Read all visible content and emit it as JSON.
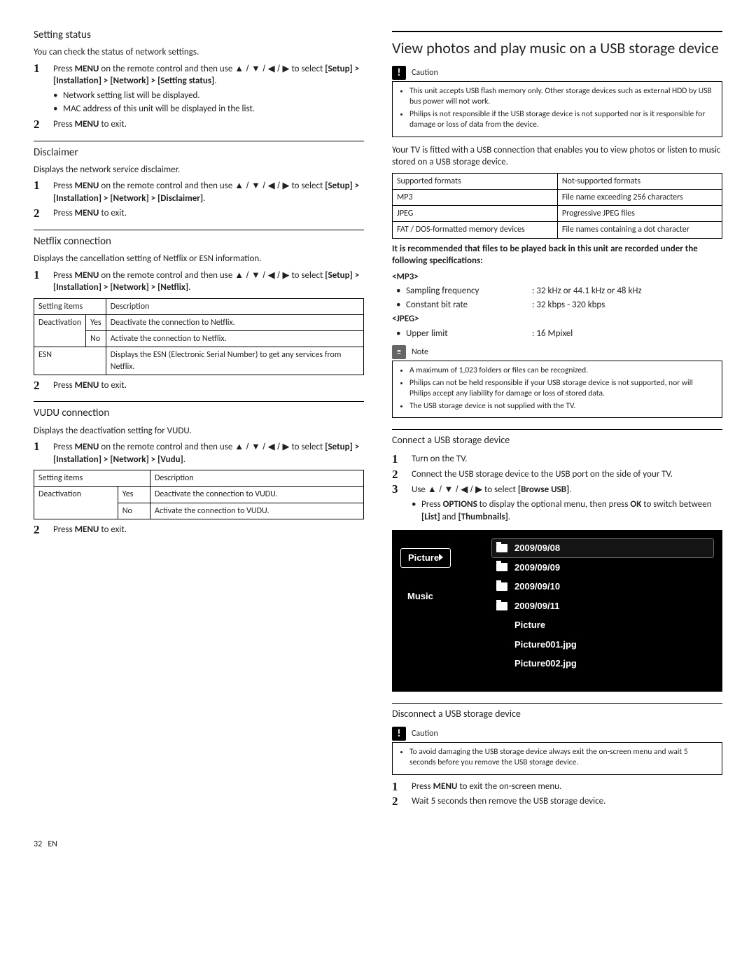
{
  "left": {
    "setting_status": {
      "title": "Setting status",
      "intro": "You can check the status of network settings.",
      "step1_a": "Press ",
      "step1_menu": "MENU",
      "step1_b": " on the remote control and then use ",
      "step1_c": " to select ",
      "path": "[Setup] > [Installation] > [Network] > [Setting status]",
      "sub1": "Network setting list will be displayed.",
      "sub2": "MAC address of this unit will be displayed in the list.",
      "step2_a": "Press ",
      "step2_b": " to exit."
    },
    "disclaimer": {
      "title": "Disclaimer",
      "intro": "Displays the network service disclaimer.",
      "step1_a": "Press ",
      "step1_menu": "MENU",
      "step1_b": " on the remote control and then use ",
      "step1_c": " to select ",
      "path": "[Setup] > [Installation] > [Network] > [Disclaimer]",
      "step2_a": "Press ",
      "step2_b": " to exit."
    },
    "netflix": {
      "title": "Netflix connection",
      "intro": "Displays the cancellation setting of Netflix or ESN information.",
      "step1_a": "Press ",
      "step1_menu": "MENU",
      "step1_b": " on the remote control and then use ",
      "step1_c": " to select ",
      "path": "[Setup] > [Installation] > [Network] > [Netflix]",
      "th1": "Setting items",
      "th2": "Description",
      "r1c1": "Deactivation",
      "r1yes": "Yes",
      "r1yes_d": "Deactivate the connection to Netflix.",
      "r1no": "No",
      "r1no_d": "Activate the connection to Netflix.",
      "r2c1": "ESN",
      "r2d": "Displays the ESN (Electronic Serial Number) to get any services from Netflix.",
      "step2_a": "Press ",
      "step2_b": " to exit."
    },
    "vudu": {
      "title": "VUDU connection",
      "intro": "Displays the deactivation setting for VUDU.",
      "step1_a": "Press ",
      "step1_menu": "MENU",
      "step1_b": " on the remote control and then use ",
      "step1_c": " to select ",
      "path": "[Setup] > [Installation] > [Network] > [Vudu]",
      "th1": "Setting items",
      "th2": "Description",
      "r1c1": "Deactivation",
      "r1yes": "Yes",
      "r1yes_d": "Deactivate the connection to VUDU.",
      "r1no": "No",
      "r1no_d": "Activate the connection to VUDU.",
      "step2_a": "Press ",
      "step2_b": " to exit."
    }
  },
  "right": {
    "heading": "View photos and play music on a USB storage device",
    "caution_label": "Caution",
    "caution_items": [
      "This unit accepts USB flash memory only. Other storage devices such as external HDD by USB bus power will not work.",
      "Philips is not responsible if the USB storage device is not supported nor is it responsible for damage or loss of data from the device."
    ],
    "intro": "Your TV is fitted with a USB connection that enables you to view photos or listen to music stored on a USB storage device.",
    "th_sup": "Supported formats",
    "th_not": "Not-supported formats",
    "rows": [
      {
        "a": "MP3",
        "b": "File name exceeding 256 characters"
      },
      {
        "a": "JPEG",
        "b": "Progressive JPEG files"
      },
      {
        "a": "FAT / DOS-formatted memory devices",
        "b": "File names containing a dot character"
      }
    ],
    "rec_lead": "It is recommended that files to be played back in this unit are recorded under the following specifications:",
    "mp3_tag": "<MP3>",
    "mp3": [
      {
        "k": "Sampling frequency",
        "v": ": 32 kHz or 44.1 kHz or 48 kHz"
      },
      {
        "k": "Constant bit rate",
        "v": ": 32 kbps - 320 kbps"
      }
    ],
    "jpeg_tag": "<JPEG>",
    "jpeg": [
      {
        "k": "Upper limit",
        "v": ": 16 Mpixel"
      }
    ],
    "note_label": "Note",
    "note_items": [
      "A maximum of 1,023 folders or files can be recognized.",
      "Philips can not be held responsible if your USB storage device is not supported, nor will Philips accept any liability for damage or loss of stored data.",
      "The USB storage device is not supplied with the TV."
    ],
    "connect": {
      "title": "Connect a USB storage device",
      "s1": "Turn on the TV.",
      "s2": "Connect the USB storage device to the USB port on the side of your TV.",
      "s3a": "Use ",
      "s3b": " to select ",
      "s3c": "[Browse USB]",
      "sub_a": "Press ",
      "sub_opt": "OPTIONS",
      "sub_b": " to display the optional menu, then press ",
      "sub_ok": "OK",
      "sub_c": " to switch between ",
      "sub_list": "[List]",
      "sub_and": " and ",
      "sub_th": "[Thumbnails]"
    },
    "usb": {
      "cat1": "Picture",
      "cat2": "Music",
      "items": [
        "2009/09/08",
        "2009/09/09",
        "2009/09/10",
        "2009/09/11",
        "Picture",
        "Picture001.jpg",
        "Picture002.jpg"
      ]
    },
    "disconnect": {
      "title": "Disconnect a USB storage device",
      "caution_label": "Caution",
      "caution": "To avoid damaging the USB storage device always exit the on-screen menu and wait 5 seconds before you remove the USB storage device.",
      "s1_a": "Press ",
      "s1_menu": "MENU",
      "s1_b": " to exit the on-screen menu.",
      "s2": "Wait 5 seconds then remove the USB storage device."
    }
  },
  "footer": {
    "page": "32",
    "lang": "EN"
  },
  "glyphs": {
    "arrows": "▲ / ▼ / ◀ / ▶"
  }
}
